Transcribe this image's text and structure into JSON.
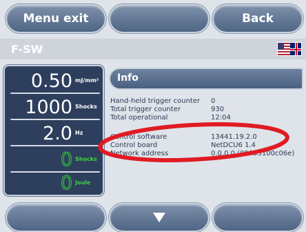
{
  "top_bar": {
    "menu_exit_label": "Menu exit",
    "middle_label": "",
    "back_label": "Back"
  },
  "title_bar": {
    "title": "F-SW",
    "language_flag_icon": "us-uk-flag-icon"
  },
  "left_panel": {
    "energy": {
      "value": "0.50",
      "unit": "mJ/mm²"
    },
    "shocks": {
      "value": "1000",
      "unit": "Shocks"
    },
    "frequency": {
      "value": "2.0",
      "unit": "Hz"
    },
    "shock_count": {
      "value": "0",
      "unit": "Shocks"
    },
    "joule": {
      "value": "0",
      "unit": "Joule"
    }
  },
  "info": {
    "header": "Info",
    "rows": [
      {
        "key": "Hand-held trigger counter",
        "value": "0"
      },
      {
        "key": "Total trigger counter",
        "value": "930"
      },
      {
        "key": "Total operational",
        "value": "12:04"
      },
      {
        "key": "Control software",
        "value": "13441.19.2.0"
      },
      {
        "key": "Control board",
        "value": "NetDCU6 1.4"
      },
      {
        "key": "Network address",
        "value": "0.0.0.0 (00055100c06e)"
      }
    ]
  },
  "bottom_bar": {
    "down_icon": "arrow-down-icon"
  },
  "colors": {
    "button": "#5d7292",
    "panel": "#2d3f5c",
    "accent_green": "#39d539",
    "annotation_red": "#e01b23"
  }
}
